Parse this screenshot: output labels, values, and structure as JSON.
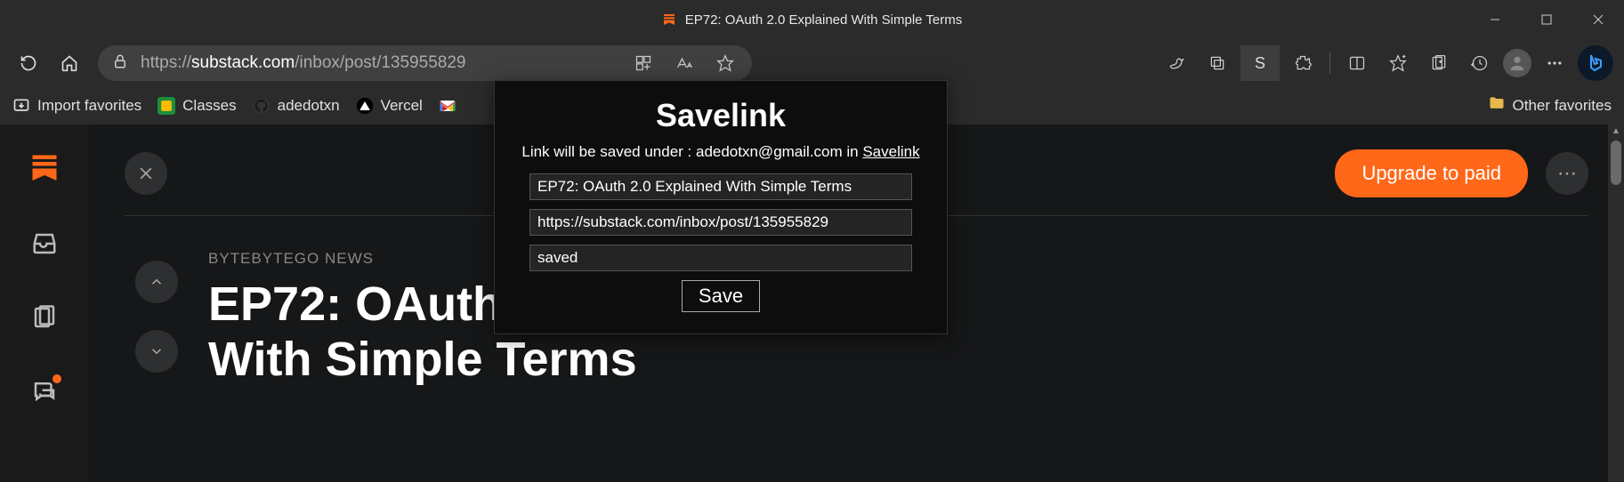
{
  "window": {
    "title": "EP72: OAuth 2.0 Explained With Simple Terms"
  },
  "address": {
    "scheme": "https://",
    "host": "substack.com",
    "path": "/inbox/post/135955829"
  },
  "bookmarks": {
    "import": "Import favorites",
    "items": [
      {
        "label": "Classes"
      },
      {
        "label": "adedotxn"
      },
      {
        "label": "Vercel"
      }
    ],
    "other": "Other favorites"
  },
  "ext_letter": "S",
  "sidebar": {},
  "article": {
    "source": "BYTEBYTEGO NEWS",
    "title": "EP72: OAuth 2.0 Explained With Simple Terms",
    "upgrade": "Upgrade to paid"
  },
  "savelink": {
    "title": "Savelink",
    "sub_prefix": "Link will be saved under : ",
    "email": "adedotxn@gmail.com",
    "sub_in": " in ",
    "brand": "Savelink",
    "field_title": "EP72: OAuth 2.0 Explained With Simple Terms",
    "field_url": "https://substack.com/inbox/post/135955829",
    "field_tag": "saved",
    "button": "Save"
  }
}
